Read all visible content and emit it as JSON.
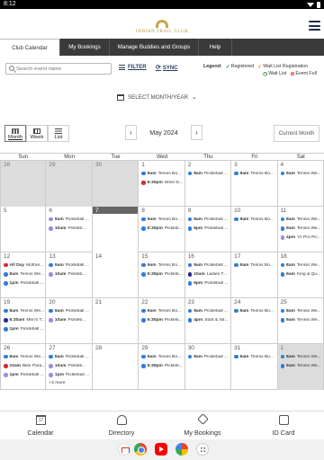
{
  "status_bar": {
    "time": "8:12"
  },
  "header": {
    "logo_text": "INDIAN TRAIL CLUB"
  },
  "tabs": [
    {
      "label": "Club Calendar",
      "active": true
    },
    {
      "label": "My Bookings",
      "active": false
    },
    {
      "label": "Manage Buddies and Groups",
      "active": false
    },
    {
      "label": "Help",
      "active": false
    }
  ],
  "toolbar": {
    "search_placeholder": "Search event name",
    "filter_label": "FILTER",
    "sync_label": "SYNC"
  },
  "legend": {
    "title": "Legend:",
    "items": [
      {
        "label": "Registered",
        "color": "#2e8b3a"
      },
      {
        "label": "Wait List Registration",
        "color": "#e08a1e"
      },
      {
        "label": "Wait List",
        "color": "#2e8b3a"
      },
      {
        "label": "Event Full",
        "color": "#d43a2a"
      }
    ]
  },
  "select_month_label": "SELECT MONTH/YEAR",
  "view_buttons": [
    {
      "label": "Month",
      "active": true
    },
    {
      "label": "Week",
      "active": false
    },
    {
      "label": "List",
      "active": false
    }
  ],
  "month_nav": {
    "prev": "‹",
    "label": "May 2024",
    "next": "›"
  },
  "current_month_label": "Current Month",
  "day_headers": [
    "Sun",
    "Mon",
    "Tue",
    "Wed",
    "Thu",
    "Fri",
    "Sat"
  ],
  "colors": {
    "blue": "#2f7fd6",
    "red": "#d42a2a",
    "purple": "#9b8ed8",
    "navy": "#2a2a9a"
  },
  "weeks": [
    [
      {
        "day": "28",
        "other": true,
        "events": []
      },
      {
        "day": "29",
        "other": true,
        "events": []
      },
      {
        "day": "30",
        "other": true,
        "events": []
      },
      {
        "day": "1",
        "events": [
          {
            "dot": "blue",
            "time": "9am",
            "title": "Tennis Bo..."
          },
          {
            "dot": "red",
            "time": "6:30pm",
            "title": "Wine D..."
          }
        ]
      },
      {
        "day": "2",
        "events": [
          {
            "dot": "blue",
            "time": "9am",
            "title": "Pickleball ..."
          }
        ]
      },
      {
        "day": "3",
        "events": [
          {
            "dot": "blue",
            "time": "9am",
            "title": "Tennis Bo..."
          }
        ]
      },
      {
        "day": "4",
        "events": [
          {
            "dot": "blue",
            "time": "9am",
            "title": "Tennis We..."
          }
        ]
      }
    ],
    [
      {
        "day": "5",
        "events": []
      },
      {
        "day": "6",
        "events": [
          {
            "dot": "purple",
            "time": "9am",
            "title": "Pickleball ..."
          },
          {
            "dot": "purple",
            "time": "10am",
            "title": "Pickleb..."
          }
        ]
      },
      {
        "day": "7",
        "today": true,
        "events": []
      },
      {
        "day": "8",
        "events": [
          {
            "dot": "blue",
            "time": "9am",
            "title": "Tennis Bo..."
          },
          {
            "dot": "blue",
            "time": "6:30pm",
            "title": "Pickleb..."
          }
        ]
      },
      {
        "day": "9",
        "events": [
          {
            "dot": "blue",
            "time": "9am",
            "title": "Pickleball ..."
          },
          {
            "dot": "blue",
            "time": "6pm",
            "title": "Pickleball ..."
          }
        ]
      },
      {
        "day": "10",
        "events": [
          {
            "dot": "blue",
            "time": "9am",
            "title": "Tennis Bo..."
          }
        ]
      },
      {
        "day": "11",
        "events": [
          {
            "dot": "blue",
            "time": "8am",
            "title": "Tennis We..."
          },
          {
            "dot": "blue",
            "time": "9am",
            "title": "Tennis We..."
          },
          {
            "dot": "purple",
            "time": "4pm",
            "title": "Yo Pro Pic..."
          }
        ]
      }
    ],
    [
      {
        "day": "12",
        "events": [
          {
            "dot": "red",
            "time": "All Day",
            "title": "Mother..."
          },
          {
            "dot": "blue",
            "time": "8am",
            "title": "Tennis We..."
          },
          {
            "dot": "blue",
            "time": "1pm",
            "title": "Pickleball ..."
          }
        ]
      },
      {
        "day": "13",
        "events": [
          {
            "dot": "blue",
            "time": "9am",
            "title": "Pickleball ..."
          },
          {
            "dot": "purple",
            "time": "10am",
            "title": "Pickleb..."
          }
        ]
      },
      {
        "day": "14",
        "events": []
      },
      {
        "day": "15",
        "events": [
          {
            "dot": "blue",
            "time": "9am",
            "title": "Tennis Bo..."
          },
          {
            "dot": "blue",
            "time": "6:30pm",
            "title": "Pickleb..."
          }
        ]
      },
      {
        "day": "16",
        "events": [
          {
            "dot": "blue",
            "time": "9am",
            "title": "Pickleball ..."
          },
          {
            "dot": "navy",
            "time": "10am",
            "title": "Ladies T..."
          },
          {
            "dot": "blue",
            "time": "6pm",
            "title": "Pickleball ..."
          }
        ]
      },
      {
        "day": "17",
        "events": [
          {
            "dot": "blue",
            "time": "9am",
            "title": "Tennis Bo..."
          }
        ]
      },
      {
        "day": "18",
        "events": [
          {
            "dot": "blue",
            "time": "8am",
            "title": "Tennis We..."
          },
          {
            "dot": "blue",
            "time": "9am",
            "title": "King & Qu..."
          }
        ]
      }
    ],
    [
      {
        "day": "19",
        "events": [
          {
            "dot": "blue",
            "time": "8am",
            "title": "Tennis We..."
          },
          {
            "dot": "navy",
            "time": "6:30am",
            "title": "Men's T..."
          },
          {
            "dot": "blue",
            "time": "1pm",
            "title": "Pickleball ..."
          }
        ]
      },
      {
        "day": "20",
        "events": [
          {
            "dot": "blue",
            "time": "9am",
            "title": "Pickleball ..."
          },
          {
            "dot": "purple",
            "time": "10am",
            "title": "Pickleb..."
          }
        ]
      },
      {
        "day": "21",
        "events": []
      },
      {
        "day": "22",
        "events": [
          {
            "dot": "blue",
            "time": "9am",
            "title": "Tennis Bo..."
          },
          {
            "dot": "blue",
            "time": "6:30pm",
            "title": "Pickleb..."
          }
        ]
      },
      {
        "day": "23",
        "events": [
          {
            "dot": "blue",
            "time": "9am",
            "title": "Pickleball ..."
          },
          {
            "dot": "blue",
            "time": "4pm",
            "title": "Start & Str..."
          }
        ]
      },
      {
        "day": "24",
        "events": [
          {
            "dot": "blue",
            "time": "9am",
            "title": "Tennis Bo..."
          }
        ]
      },
      {
        "day": "25",
        "events": [
          {
            "dot": "blue",
            "time": "8am",
            "title": "Tennis We..."
          },
          {
            "dot": "blue",
            "time": "9am",
            "title": "Tennis We..."
          }
        ]
      }
    ],
    [
      {
        "day": "26",
        "events": [
          {
            "dot": "blue",
            "time": "8am",
            "title": "Tennis We..."
          },
          {
            "dot": "red",
            "time": "10am",
            "title": "Bike Para..."
          },
          {
            "dot": "purple",
            "time": "1pm",
            "title": "Pickleball ..."
          }
        ]
      },
      {
        "day": "27",
        "events": [
          {
            "dot": "blue",
            "time": "9am",
            "title": "Pickleball ..."
          },
          {
            "dot": "purple",
            "time": "10am",
            "title": "Pickleb..."
          },
          {
            "dot": "purple",
            "time": "1pm",
            "title": "Pickleball ..."
          }
        ],
        "more": "+2 more"
      },
      {
        "day": "28",
        "events": []
      },
      {
        "day": "29",
        "events": [
          {
            "dot": "blue",
            "time": "9am",
            "title": "Tennis Bo..."
          },
          {
            "dot": "blue",
            "time": "6:30pm",
            "title": "Pickleb..."
          }
        ]
      },
      {
        "day": "30",
        "events": [
          {
            "dot": "blue",
            "time": "9am",
            "title": "Pickleball ..."
          }
        ]
      },
      {
        "day": "31",
        "events": [
          {
            "dot": "blue",
            "time": "9am",
            "title": "Tennis Bo..."
          }
        ]
      },
      {
        "day": "1",
        "other": true,
        "events": [
          {
            "dot": "blue",
            "time": "8am",
            "title": "Tennis We..."
          },
          {
            "dot": "blue",
            "time": "9am",
            "title": "Tennis We..."
          }
        ]
      }
    ]
  ],
  "bottom_nav": [
    {
      "label": "Calendar",
      "icon": "calendar-icon",
      "glyph": "17"
    },
    {
      "label": "Directory",
      "icon": "directory-icon",
      "glyph": ""
    },
    {
      "label": "My Bookings",
      "icon": "tag-icon",
      "glyph": ""
    },
    {
      "label": "ID Card",
      "icon": "id-card-icon",
      "glyph": ""
    }
  ]
}
